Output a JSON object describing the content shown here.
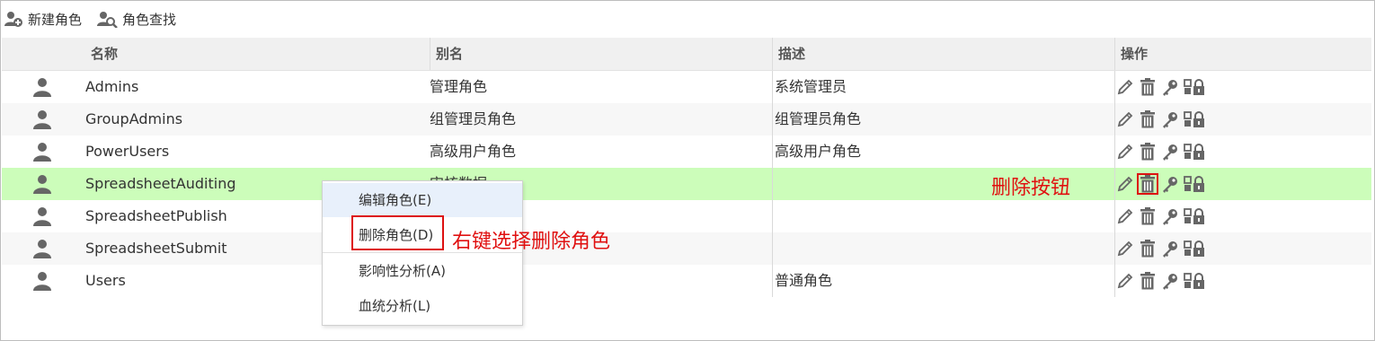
{
  "toolbar": {
    "new_role_label": "新建角色",
    "find_role_label": "角色查找"
  },
  "table": {
    "headers": {
      "name": "名称",
      "alias": "别名",
      "desc": "描述",
      "ops": "操作"
    },
    "rows": [
      {
        "name": "Admins",
        "alias": "管理角色",
        "desc": "系统管理员"
      },
      {
        "name": "GroupAdmins",
        "alias": "组管理员角色",
        "desc": "组管理员角色"
      },
      {
        "name": "PowerUsers",
        "alias": "高级用户角色",
        "desc": "高级用户角色"
      },
      {
        "name": "SpreadsheetAuditing",
        "alias": "审核数据",
        "desc": ""
      },
      {
        "name": "SpreadsheetPublish",
        "alias": "",
        "desc": ""
      },
      {
        "name": "SpreadsheetSubmit",
        "alias": "",
        "desc": ""
      },
      {
        "name": "Users",
        "alias": "",
        "desc": "普通角色"
      }
    ],
    "selected_row": 3
  },
  "context_menu": {
    "items": [
      "编辑角色(E)",
      "删除角色(D)",
      "影响性分析(A)",
      "血统分析(L)"
    ]
  },
  "annotations": {
    "delete_button_note": "删除按钮",
    "right_click_note": "右键选择删除角色"
  },
  "icons": {
    "row_icon": "user-icon",
    "ops": [
      "edit-pencil-icon",
      "delete-trash-icon",
      "key-icon",
      "permission-lock-icon"
    ]
  },
  "colors": {
    "selected_row": "#ccfdba",
    "annotation_red": "#e01010",
    "icon_gray": "#666666"
  }
}
